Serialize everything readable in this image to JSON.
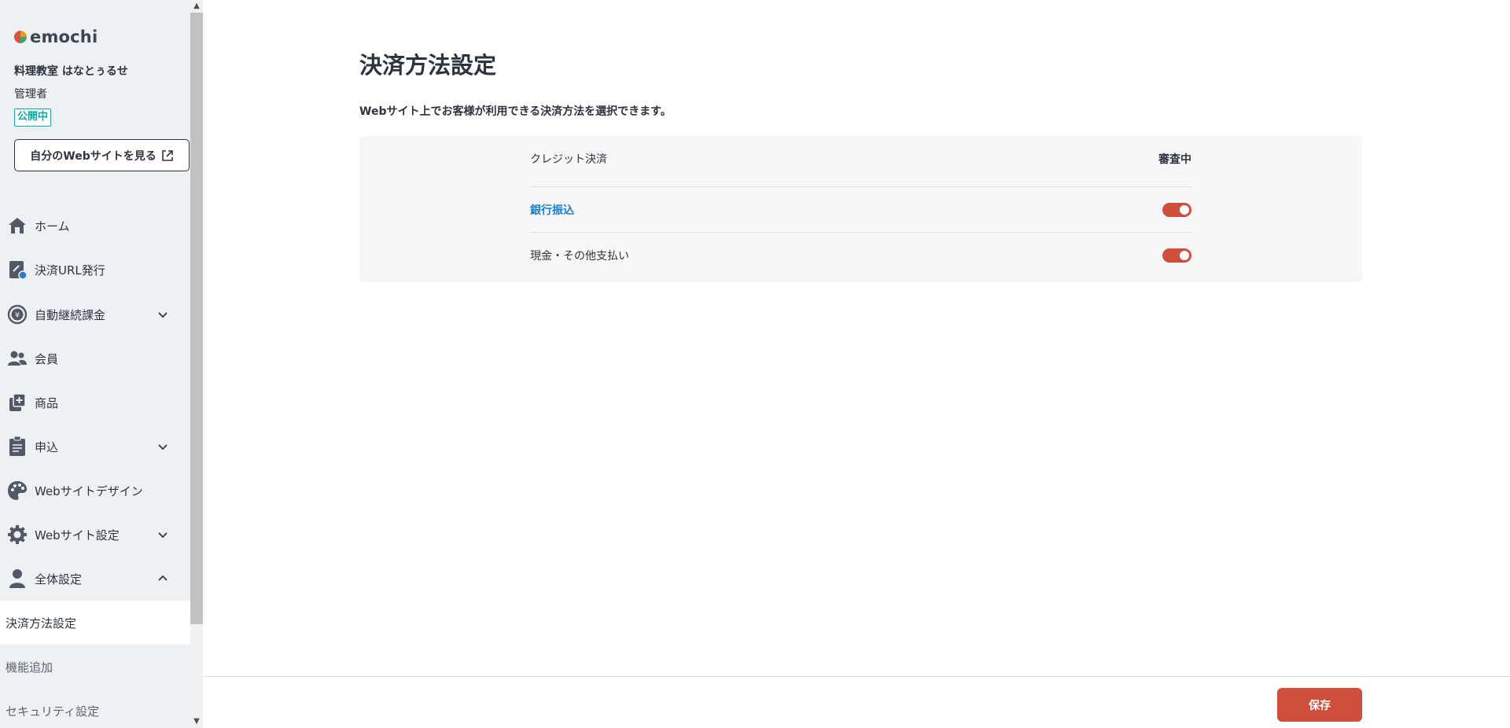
{
  "brand": {
    "name": "emochi"
  },
  "account": {
    "school_name": "料理教室 はなとぅるせ",
    "role": "管理者",
    "status": "公開中"
  },
  "sidebar": {
    "view_site_label": "自分のWebサイトを見る",
    "items": [
      {
        "label": "ホーム",
        "icon": "home-icon",
        "expandable": false
      },
      {
        "label": "決済URL発行",
        "icon": "link-icon",
        "expandable": false
      },
      {
        "label": "自動継続課金",
        "icon": "yen-refresh-icon",
        "expandable": true,
        "expanded": false
      },
      {
        "label": "会員",
        "icon": "users-icon",
        "expandable": false
      },
      {
        "label": "商品",
        "icon": "product-add-icon",
        "expandable": false
      },
      {
        "label": "申込",
        "icon": "clipboard-icon",
        "expandable": true,
        "expanded": false
      },
      {
        "label": "Webサイトデザイン",
        "icon": "palette-icon",
        "expandable": false
      },
      {
        "label": "Webサイト設定",
        "icon": "gear-icon",
        "expandable": true,
        "expanded": false
      },
      {
        "label": "全体設定",
        "icon": "person-icon",
        "expandable": true,
        "expanded": true
      }
    ],
    "sub_items": [
      {
        "label": "決済方法設定",
        "active": true
      },
      {
        "label": "機能追加",
        "active": false
      },
      {
        "label": "セキュリティ設定",
        "active": false
      }
    ]
  },
  "main": {
    "title": "決済方法設定",
    "description": "Webサイト上でお客様が利用できる決済方法を選択できます。",
    "methods": [
      {
        "label": "クレジット決済",
        "status": "審査中",
        "type": "status"
      },
      {
        "label": "銀行振込",
        "enabled": true,
        "type": "toggle",
        "link": true
      },
      {
        "label": "現金・その他支払い",
        "enabled": true,
        "type": "toggle",
        "link": false
      }
    ],
    "save_label": "保存"
  },
  "colors": {
    "accent": "#cf4f3c",
    "link": "#1a7fd4",
    "badge": "#1aa5a5",
    "sidebar_bg": "#edf1f4"
  }
}
